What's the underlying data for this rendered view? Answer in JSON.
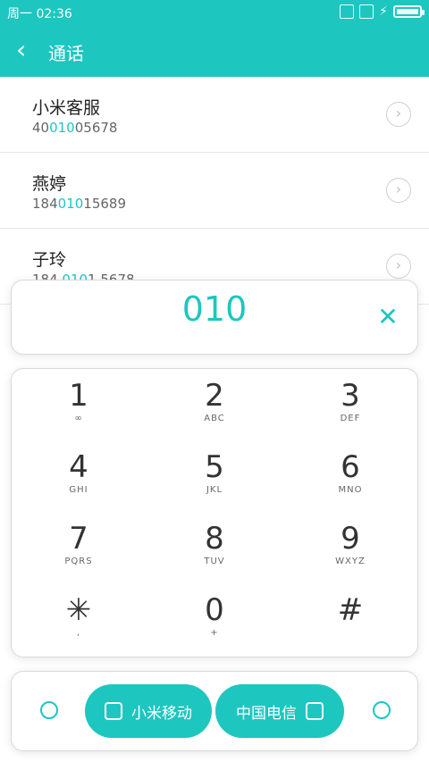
{
  "status": {
    "time": "周一 02:36"
  },
  "header": {
    "back_icon": "chevron-left-icon",
    "title": "通话"
  },
  "contacts": [
    {
      "name": "小米客服",
      "num_pre": "40",
      "num_hl": "010",
      "num_post": "05678"
    },
    {
      "name": "燕婷",
      "num_pre": "184",
      "num_hl": "010",
      "num_post": "15689"
    },
    {
      "name": "子玲",
      "num_pre": "184 ",
      "num_hl": "010",
      "num_post": "1 5678"
    }
  ],
  "dialer": {
    "digits": "010",
    "clear_icon": "close-icon",
    "keys": [
      {
        "digit": "1",
        "letters": "∞"
      },
      {
        "digit": "2",
        "letters": "ABC"
      },
      {
        "digit": "3",
        "letters": "DEF"
      },
      {
        "digit": "4",
        "letters": "GHI"
      },
      {
        "digit": "5",
        "letters": "JKL"
      },
      {
        "digit": "6",
        "letters": "MNO"
      },
      {
        "digit": "7",
        "letters": "PQRS"
      },
      {
        "digit": "8",
        "letters": "TUV"
      },
      {
        "digit": "9",
        "letters": "WXYZ"
      },
      {
        "digit": "✳",
        "letters": ","
      },
      {
        "digit": "0",
        "letters": "+"
      },
      {
        "digit": "#",
        "letters": ""
      }
    ]
  },
  "call_bar": {
    "sim1_label": "小米移动",
    "sim2_label": "中国电信"
  },
  "colors": {
    "accent": "#1ec6c0"
  }
}
